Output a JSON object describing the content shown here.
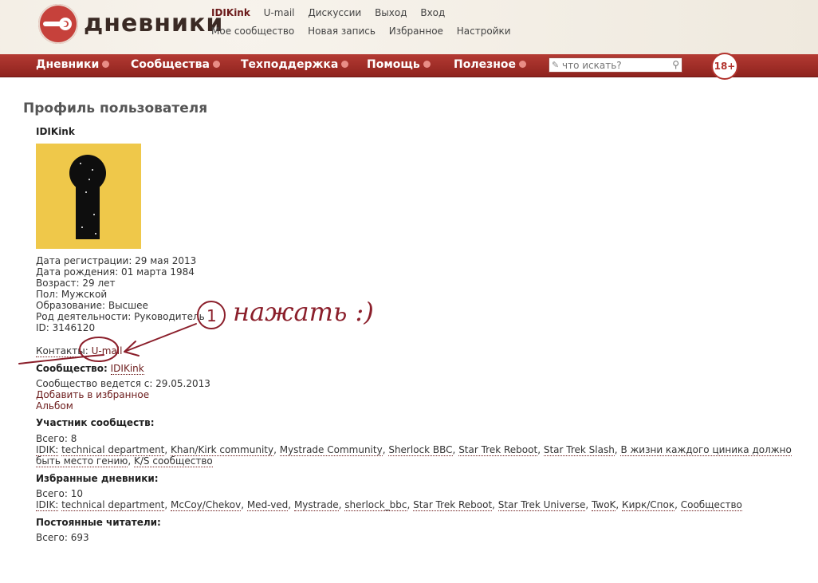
{
  "header": {
    "logo_text": "дневники",
    "user": "IDIKink",
    "links_row1": [
      "U-mail",
      "Дискуссии",
      "Выход",
      "Вход"
    ],
    "links_row2": [
      "Мое сообщество",
      "Новая запись",
      "Избранное",
      "Настройки"
    ]
  },
  "nav": {
    "items": [
      "Дневники",
      "Сообщества",
      "Техподдержка",
      "Помощь",
      "Полезное"
    ],
    "search_placeholder": "что искать?",
    "age_badge": "18+"
  },
  "profile": {
    "title": "Профиль пользователя",
    "username": "IDIKink",
    "info": [
      "Дата регистрации: 29 мая 2013",
      "Дата рождения: 01 марта 1984",
      "Возраст: 29 лет",
      "Пол: Мужской",
      "Образование: Высшее",
      "Род деятельности: Руководитель",
      "ID: 3146120"
    ],
    "contacts_label": "Контакты:",
    "contacts_link": "U-mail",
    "community_label": "Сообщество:",
    "community_link": "IDIKink",
    "community_since": "Сообщество ведется с: 29.05.2013",
    "add_favorite": "Добавить в избранное",
    "album": "Альбом",
    "member_of_heading": "Участник сообществ:",
    "member_of_total": "Всего: 8",
    "member_of_prefix": "IDIK:",
    "member_of": [
      "technical department",
      "Khan/Kirk community",
      "Mystrade Community",
      "Sherlock BBC",
      "Star Trek Reboot",
      "Star Trek Slash",
      "В жизни каждого циника должно быть место гению",
      "K/S сообщество"
    ],
    "fav_heading": "Избранные дневники:",
    "fav_total": "Всего: 10",
    "fav_prefix": "IDIK:",
    "favorites": [
      "technical department",
      "McCoy/Chekov",
      "Med-ved",
      "Mystrade",
      "sherlock_bbc",
      "Star Trek Reboot",
      "Star Trek Universe",
      "TwoK",
      "Кирк/Спок",
      "Сообщество"
    ],
    "readers_heading": "Постоянные читатели:",
    "readers_total": "Всего: 693"
  },
  "annotation": {
    "text": "нажать :)",
    "number": "1",
    "color": "#8b1f2b"
  }
}
